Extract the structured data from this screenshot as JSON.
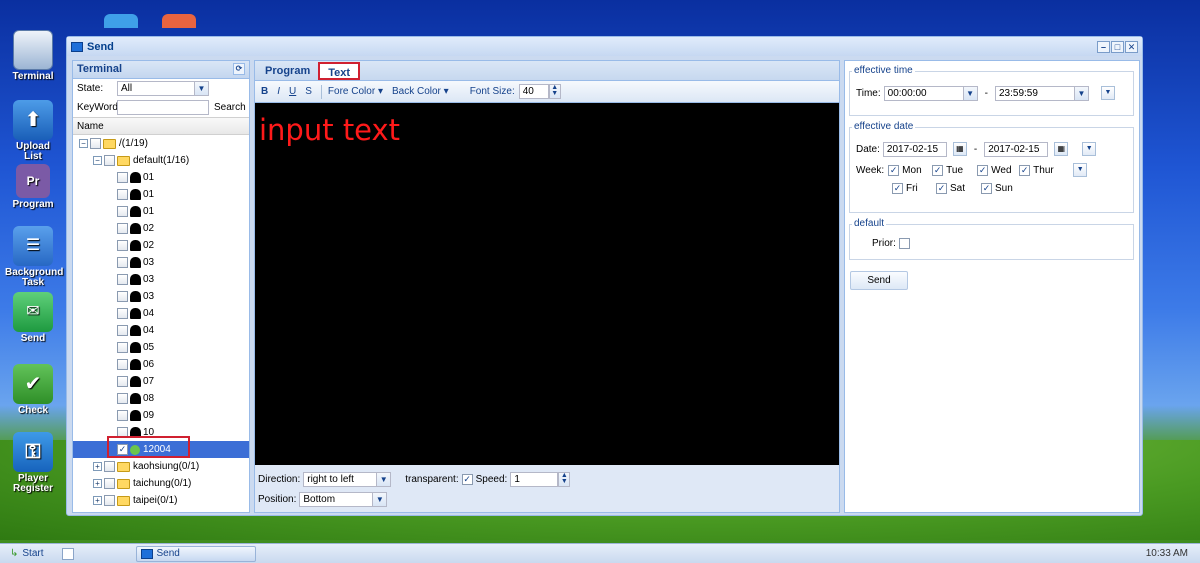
{
  "desktop": {
    "icons": [
      {
        "label": "Terminal"
      },
      {
        "label": "Upload List"
      },
      {
        "label": "Program"
      },
      {
        "label": "Background Task"
      },
      {
        "label": "Send"
      },
      {
        "label": "Check"
      },
      {
        "label": "Player Register"
      }
    ]
  },
  "window": {
    "title": "Send",
    "controls": [
      "minimize",
      "maximize",
      "close"
    ]
  },
  "left_panel": {
    "title": "Terminal",
    "state_label": "State:",
    "state_value": "All",
    "keyword_label": "KeyWord",
    "keyword_value": "",
    "search_label": "Search",
    "column_name": "Name",
    "root": "/(1/19)",
    "group": "default(1/16)",
    "devices": [
      "01",
      "01",
      "01",
      "02",
      "02",
      "03",
      "03",
      "03",
      "04",
      "04",
      "05",
      "06",
      "07",
      "08",
      "09",
      "10"
    ],
    "selected_device": "12004",
    "other_groups": [
      "kaohsiung(0/1)",
      "taichung(0/1)",
      "taipei(0/1)"
    ]
  },
  "center_panel": {
    "tabs": [
      {
        "label": "Program"
      },
      {
        "label": "Text"
      }
    ],
    "active_tab": "Text",
    "toolbar": {
      "bold": "B",
      "italic": "I",
      "underline": "U",
      "strike": "S",
      "fore_color": "Fore Color",
      "back_color": "Back Color",
      "font_size_label": "Font Size:",
      "font_size_value": "40"
    },
    "canvas_text": "input text",
    "direction_label": "Direction:",
    "direction_value": "right to left",
    "transparent_label": "transparent:",
    "speed_label": "Speed:",
    "speed_value": "1",
    "position_label": "Position:",
    "position_value": "Bottom"
  },
  "right_panel": {
    "effective_time_legend": "effective time",
    "time_label": "Time:",
    "time_start": "00:00:00",
    "time_end": "23:59:59",
    "dash": "-",
    "effective_date_legend": "effective date",
    "date_label": "Date:",
    "date_start": "2017-02-15",
    "date_end": "2017-02-15",
    "week_label": "Week:",
    "week_days": [
      "Mon",
      "Tue",
      "Wed",
      "Thur",
      "Fri",
      "Sat",
      "Sun"
    ],
    "default_legend": "default",
    "prior_label": "Prior:",
    "send_button": "Send"
  },
  "taskbar": {
    "start": "Start",
    "task": "Send",
    "clock": "10:33 AM"
  },
  "colors": {
    "accent": "#15428b",
    "highlight": "#d02030",
    "canvas_text": "#ff1a1a"
  }
}
